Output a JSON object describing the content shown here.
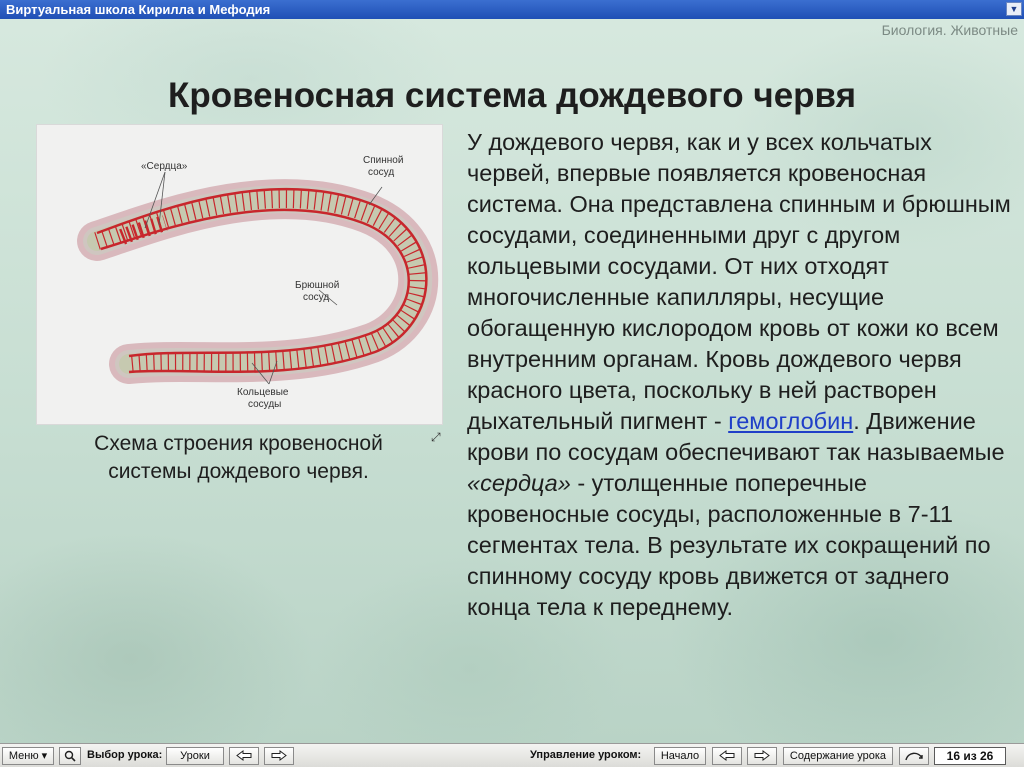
{
  "window": {
    "title": "Виртуальная школа Кирилла и Мефодия"
  },
  "header": {
    "subject": "Биология. Животные"
  },
  "slide": {
    "title": "Кровеносная система дождевого червя",
    "figure": {
      "labels": {
        "hearts": "«Сердца»",
        "dorsal_1": "Спинной",
        "dorsal_2": "сосуд",
        "ventral_1": "Брюшной",
        "ventral_2": "сосуд",
        "ring_1": "Кольцевые",
        "ring_2": "сосуды"
      },
      "enlarge_icon": "enlarge-icon",
      "colors": {
        "vessel": "#c8262c",
        "body": "#cfc6c0",
        "glow": "#d9b9bd"
      }
    },
    "caption_line1": "Схема строения кровеносной",
    "caption_line2": "системы дождевого червя.",
    "text_part1": "У дождевого червя, как и у всех кольчатых червей, впервые появляется кровеносная система. Она представлена спинным и брюшным сосудами, соединенными друг с другом кольцевыми сосудами. От них отходят многочисленные капилляры, несущие обогащенную кислородом кровь от кожи ко всем внутренним органам. Кровь дождевого червя красного цвета, поскольку в ней растворен дыхательный пигмент - ",
    "text_link": "гемоглобин",
    "text_part2": ". Движение крови по сосудам обеспечивают так называемые ",
    "text_italic": "«сердца»",
    "text_part3": " - утолщенные поперечные кровеносные сосуды, расположенные в 7-11 сегментах тела. В результате их сокращений по спинному сосуду кровь движется от заднего конца тела к переднему."
  },
  "toolbar": {
    "menu_label": "Меню",
    "lesson_select_label": "Выбор урока:",
    "lessons_button": "Уроки",
    "lesson_control_label": "Управление уроком:",
    "start_button": "Начало",
    "contents_button": "Содержание урока",
    "page_counter": "16 из 26"
  }
}
